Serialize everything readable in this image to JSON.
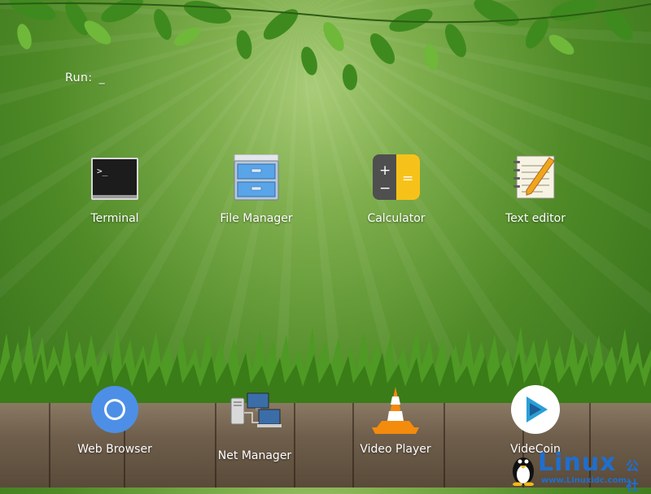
{
  "run_prompt": {
    "label": "Run:",
    "cursor": "_"
  },
  "apps_top": [
    {
      "label": "Terminal",
      "icon": "terminal-icon"
    },
    {
      "label": "File Manager",
      "icon": "file-cabinet-icon"
    },
    {
      "label": "Calculator",
      "icon": "calculator-icon"
    },
    {
      "label": "Text editor",
      "icon": "notepad-pencil-icon"
    }
  ],
  "apps_bottom": [
    {
      "label": "Web Browser",
      "icon": "chromium-icon"
    },
    {
      "label": "Net Manager",
      "icon": "network-computers-icon"
    },
    {
      "label": "Video Player",
      "icon": "vlc-cone-icon"
    },
    {
      "label": "VideCoin",
      "icon": "play-circle-icon"
    }
  ],
  "watermark": {
    "text": "Linux",
    "cn": "公社",
    "url": "www.Linuxidc.com"
  },
  "colors": {
    "terminal_bg": "#1c1c1c",
    "calculator_left": "#4f4f4f",
    "calculator_right": "#f6c21a",
    "browser_blue": "#4d8fe6",
    "vlc_orange": "#f48b0c",
    "watermark_blue": "#1e6fd0"
  }
}
